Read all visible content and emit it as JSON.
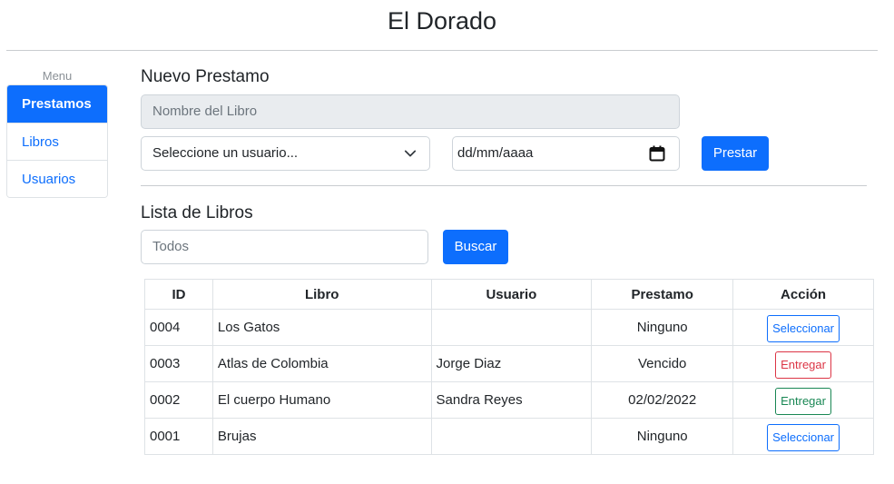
{
  "app": {
    "title": "El Dorado"
  },
  "sidebar": {
    "menu_label": "Menu",
    "items": [
      {
        "label": "Prestamos",
        "active": true
      },
      {
        "label": "Libros",
        "active": false
      },
      {
        "label": "Usuarios",
        "active": false
      }
    ]
  },
  "loan_form": {
    "title": "Nuevo Prestamo",
    "book_placeholder": "Nombre del Libro",
    "user_select_value": "Seleccione un usuario...",
    "date_value": "dd/mm/aaaa",
    "submit_label": "Prestar"
  },
  "book_list": {
    "title": "Lista de Libros",
    "search_placeholder": "Todos",
    "search_button": "Buscar",
    "columns": [
      "ID",
      "Libro",
      "Usuario",
      "Prestamo",
      "Acción"
    ],
    "rows": [
      {
        "id": "0004",
        "libro": "Los Gatos",
        "usuario": "",
        "prestamo": "Ninguno",
        "accion": "Seleccionar",
        "accion_color": "#0d6efd"
      },
      {
        "id": "0003",
        "libro": "Atlas de Colombia",
        "usuario": "Jorge Diaz",
        "prestamo": "Vencido",
        "accion": "Entregar",
        "accion_color": "#dc3545"
      },
      {
        "id": "0002",
        "libro": "El cuerpo Humano",
        "usuario": "Sandra Reyes",
        "prestamo": "02/02/2022",
        "accion": "Entregar",
        "accion_color": "#198754"
      },
      {
        "id": "0001",
        "libro": "Brujas",
        "usuario": "",
        "prestamo": "Ninguno",
        "accion": "Seleccionar",
        "accion_color": "#0d6efd"
      }
    ]
  },
  "colors": {
    "primary": "#0d6efd",
    "danger": "#dc3545",
    "success": "#198754"
  },
  "icons": {
    "select": "chevron-down-icon",
    "date": "calendar-icon"
  }
}
